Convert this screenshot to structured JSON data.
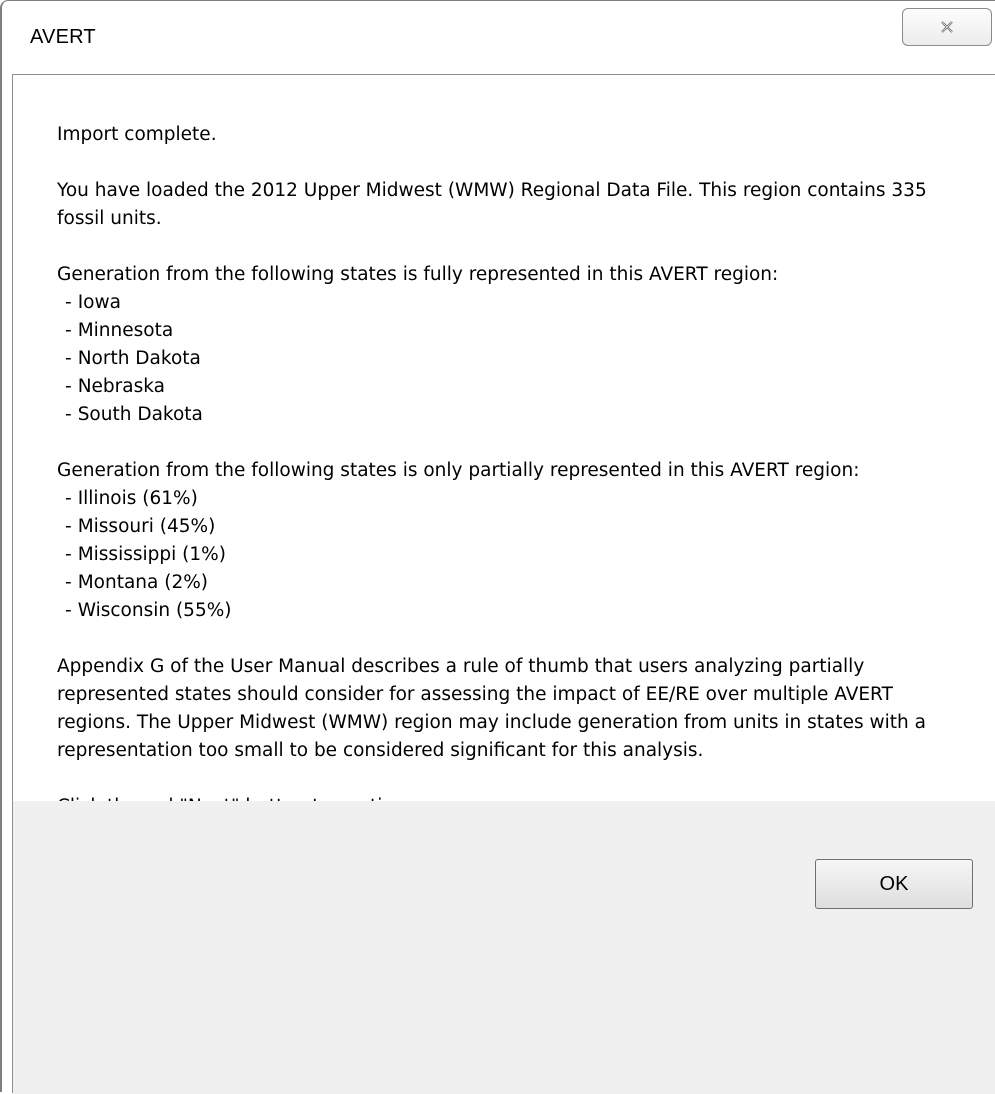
{
  "window": {
    "title": "AVERT",
    "close_icon": "close-icon"
  },
  "message": {
    "status": "Import complete.",
    "loaded": "You have loaded the 2012 Upper Midwest (WMW) Regional Data File. This region contains 335 fossil units.",
    "full_heading": "Generation from the following states is fully represented in this AVERT region:",
    "full_states": [
      "Iowa",
      "Minnesota",
      "North Dakota",
      "Nebraska",
      "South Dakota"
    ],
    "partial_heading": "Generation from the following states is only partially represented in this AVERT region:",
    "partial_states": [
      "Illinois (61%)",
      "Missouri (45%)",
      "Mississippi (1%)",
      "Montana (2%)",
      "Wisconsin (55%)"
    ],
    "appendix": "Appendix G of the User Manual describes a rule of thumb that users analyzing partially represented states should consider for assessing the impact of EE/RE over multiple AVERT regions. The Upper Midwest (WMW) region may include generation from units in states with a representation too small to be considered significant for this analysis.",
    "instruction": "Click the red \"Next\" button to continue."
  },
  "buttons": {
    "ok_label": "OK"
  }
}
